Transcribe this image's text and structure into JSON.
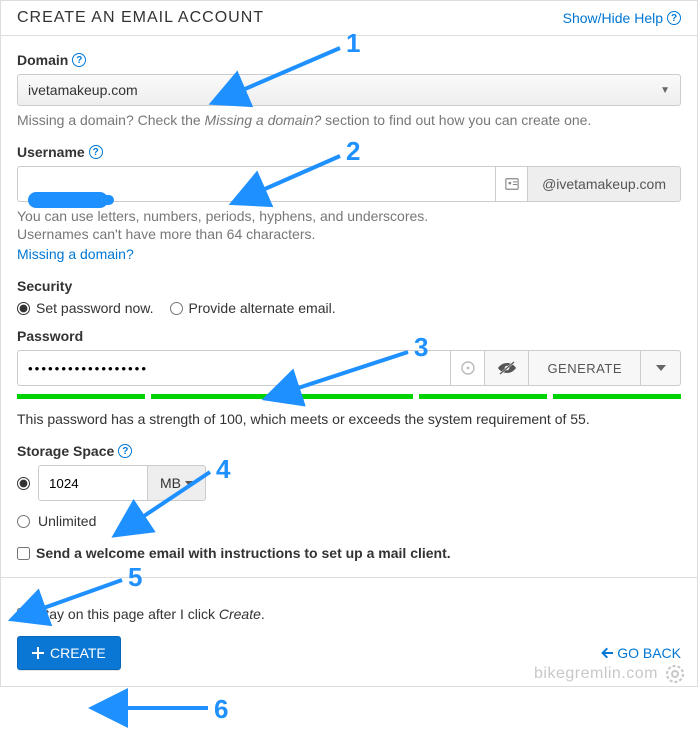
{
  "header": {
    "title": "CREATE AN EMAIL ACCOUNT",
    "help_link": "Show/Hide Help"
  },
  "domain": {
    "label": "Domain",
    "selected": "ivetamakeup.com",
    "hint_prefix": "Missing a domain? Check the ",
    "hint_em": "Missing a domain?",
    "hint_suffix": " section to find out how you can create one."
  },
  "username": {
    "label": "Username",
    "value": "",
    "suffix": "@ivetamakeup.com",
    "hint1": "You can use letters, numbers, periods, hyphens, and underscores.",
    "hint2": "Usernames can't have more than 64 characters.",
    "missing_link": "Missing a domain?"
  },
  "security": {
    "label": "Security",
    "opt_now": "Set password now.",
    "opt_alt": "Provide alternate email."
  },
  "password": {
    "label": "Password",
    "value": "••••••••••••••••••",
    "generate": "GENERATE",
    "strength_text": "This password has a strength of 100, which meets or exceeds the system requirement of 55."
  },
  "storage": {
    "label": "Storage Space",
    "value": "1024",
    "unit": "MB",
    "unlimited": "Unlimited"
  },
  "welcome": {
    "label": "Send a welcome email with instructions to set up a mail client."
  },
  "footer": {
    "stay_prefix": "Stay on this page after I click ",
    "stay_em": "Create",
    "stay_suffix": ".",
    "create": "CREATE",
    "go_back": "GO BACK"
  },
  "annotations": {
    "n1": "1",
    "n2": "2",
    "n3": "3",
    "n4": "4",
    "n5": "5",
    "n6": "6"
  },
  "watermark": "bikegremlin.com"
}
